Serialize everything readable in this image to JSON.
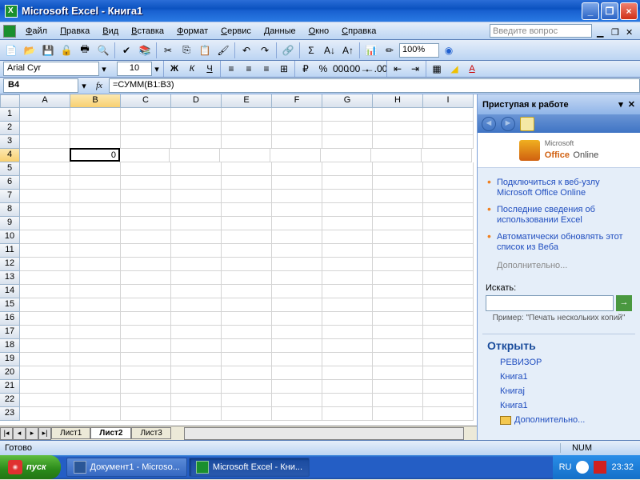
{
  "window": {
    "title": "Microsoft Excel - Книга1"
  },
  "menu": {
    "items": [
      "Файл",
      "Правка",
      "Вид",
      "Вставка",
      "Формат",
      "Сервис",
      "Данные",
      "Окно",
      "Справка"
    ],
    "ask_placeholder": "Введите вопрос"
  },
  "formatbar": {
    "font": "Arial Cyr",
    "size": "10"
  },
  "cellref": {
    "name": "B4",
    "formula": "=СУММ(B1:B3)"
  },
  "grid": {
    "columns": [
      "A",
      "B",
      "C",
      "D",
      "E",
      "F",
      "G",
      "H",
      "I"
    ],
    "active_col": "B",
    "active_row": 4,
    "active_value": "0",
    "row_count": 23
  },
  "sheets": {
    "tabs": [
      "Лист1",
      "Лист2",
      "Лист3"
    ],
    "active": "Лист2"
  },
  "pane": {
    "title": "Приступая к работе",
    "online": "Office Online",
    "online_prefix": "Microsoft",
    "links": [
      "Подключиться к веб-узлу Microsoft Office Online",
      "Последние сведения об использовании Excel",
      "Автоматически обновлять этот список из Веба"
    ],
    "more": "Дополнительно...",
    "search_label": "Искать:",
    "search_hint": "Пример: \"Печать нескольких копий\"",
    "open_title": "Открыть",
    "recent": [
      "РЕВИЗОР",
      "Книга1",
      "Книгаj",
      "Книга1"
    ],
    "open_more": "Дополнительно..."
  },
  "status": {
    "ready": "Готово",
    "num": "NUM"
  },
  "taskbar": {
    "start": "пуск",
    "items": [
      {
        "label": "Документ1 - Microso...",
        "active": false,
        "color": "#2b5797"
      },
      {
        "label": "Microsoft Excel - Кни...",
        "active": true,
        "color": "#1a8f2e"
      }
    ],
    "lang": "RU",
    "time": "23:32"
  }
}
